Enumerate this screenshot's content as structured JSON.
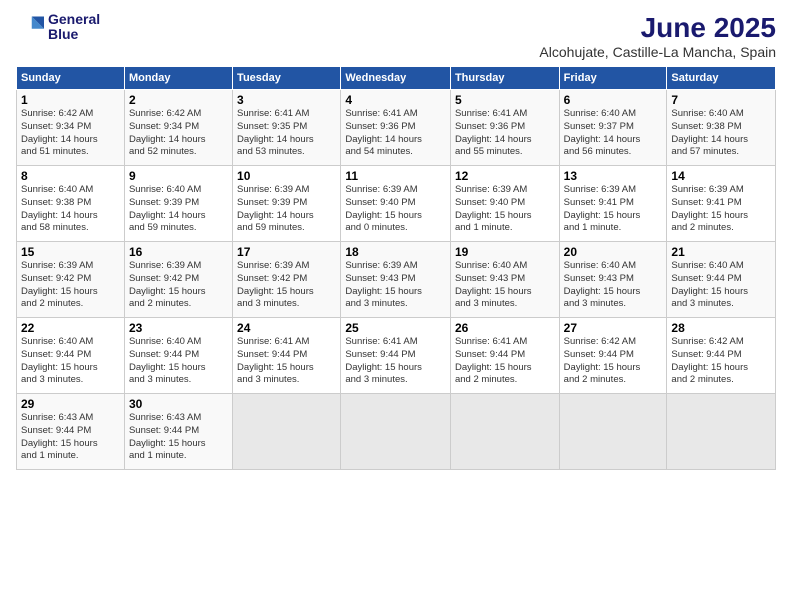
{
  "logo": {
    "line1": "General",
    "line2": "Blue"
  },
  "title": "June 2025",
  "subtitle": "Alcohujate, Castille-La Mancha, Spain",
  "days_of_week": [
    "Sunday",
    "Monday",
    "Tuesday",
    "Wednesday",
    "Thursday",
    "Friday",
    "Saturday"
  ],
  "weeks": [
    [
      {
        "day": "1",
        "info": "Sunrise: 6:42 AM\nSunset: 9:34 PM\nDaylight: 14 hours\nand 51 minutes."
      },
      {
        "day": "2",
        "info": "Sunrise: 6:42 AM\nSunset: 9:34 PM\nDaylight: 14 hours\nand 52 minutes."
      },
      {
        "day": "3",
        "info": "Sunrise: 6:41 AM\nSunset: 9:35 PM\nDaylight: 14 hours\nand 53 minutes."
      },
      {
        "day": "4",
        "info": "Sunrise: 6:41 AM\nSunset: 9:36 PM\nDaylight: 14 hours\nand 54 minutes."
      },
      {
        "day": "5",
        "info": "Sunrise: 6:41 AM\nSunset: 9:36 PM\nDaylight: 14 hours\nand 55 minutes."
      },
      {
        "day": "6",
        "info": "Sunrise: 6:40 AM\nSunset: 9:37 PM\nDaylight: 14 hours\nand 56 minutes."
      },
      {
        "day": "7",
        "info": "Sunrise: 6:40 AM\nSunset: 9:38 PM\nDaylight: 14 hours\nand 57 minutes."
      }
    ],
    [
      {
        "day": "8",
        "info": "Sunrise: 6:40 AM\nSunset: 9:38 PM\nDaylight: 14 hours\nand 58 minutes."
      },
      {
        "day": "9",
        "info": "Sunrise: 6:40 AM\nSunset: 9:39 PM\nDaylight: 14 hours\nand 59 minutes."
      },
      {
        "day": "10",
        "info": "Sunrise: 6:39 AM\nSunset: 9:39 PM\nDaylight: 14 hours\nand 59 minutes."
      },
      {
        "day": "11",
        "info": "Sunrise: 6:39 AM\nSunset: 9:40 PM\nDaylight: 15 hours\nand 0 minutes."
      },
      {
        "day": "12",
        "info": "Sunrise: 6:39 AM\nSunset: 9:40 PM\nDaylight: 15 hours\nand 1 minute."
      },
      {
        "day": "13",
        "info": "Sunrise: 6:39 AM\nSunset: 9:41 PM\nDaylight: 15 hours\nand 1 minute."
      },
      {
        "day": "14",
        "info": "Sunrise: 6:39 AM\nSunset: 9:41 PM\nDaylight: 15 hours\nand 2 minutes."
      }
    ],
    [
      {
        "day": "15",
        "info": "Sunrise: 6:39 AM\nSunset: 9:42 PM\nDaylight: 15 hours\nand 2 minutes."
      },
      {
        "day": "16",
        "info": "Sunrise: 6:39 AM\nSunset: 9:42 PM\nDaylight: 15 hours\nand 2 minutes."
      },
      {
        "day": "17",
        "info": "Sunrise: 6:39 AM\nSunset: 9:42 PM\nDaylight: 15 hours\nand 3 minutes."
      },
      {
        "day": "18",
        "info": "Sunrise: 6:39 AM\nSunset: 9:43 PM\nDaylight: 15 hours\nand 3 minutes."
      },
      {
        "day": "19",
        "info": "Sunrise: 6:40 AM\nSunset: 9:43 PM\nDaylight: 15 hours\nand 3 minutes."
      },
      {
        "day": "20",
        "info": "Sunrise: 6:40 AM\nSunset: 9:43 PM\nDaylight: 15 hours\nand 3 minutes."
      },
      {
        "day": "21",
        "info": "Sunrise: 6:40 AM\nSunset: 9:44 PM\nDaylight: 15 hours\nand 3 minutes."
      }
    ],
    [
      {
        "day": "22",
        "info": "Sunrise: 6:40 AM\nSunset: 9:44 PM\nDaylight: 15 hours\nand 3 minutes."
      },
      {
        "day": "23",
        "info": "Sunrise: 6:40 AM\nSunset: 9:44 PM\nDaylight: 15 hours\nand 3 minutes."
      },
      {
        "day": "24",
        "info": "Sunrise: 6:41 AM\nSunset: 9:44 PM\nDaylight: 15 hours\nand 3 minutes."
      },
      {
        "day": "25",
        "info": "Sunrise: 6:41 AM\nSunset: 9:44 PM\nDaylight: 15 hours\nand 3 minutes."
      },
      {
        "day": "26",
        "info": "Sunrise: 6:41 AM\nSunset: 9:44 PM\nDaylight: 15 hours\nand 2 minutes."
      },
      {
        "day": "27",
        "info": "Sunrise: 6:42 AM\nSunset: 9:44 PM\nDaylight: 15 hours\nand 2 minutes."
      },
      {
        "day": "28",
        "info": "Sunrise: 6:42 AM\nSunset: 9:44 PM\nDaylight: 15 hours\nand 2 minutes."
      }
    ],
    [
      {
        "day": "29",
        "info": "Sunrise: 6:43 AM\nSunset: 9:44 PM\nDaylight: 15 hours\nand 1 minute."
      },
      {
        "day": "30",
        "info": "Sunrise: 6:43 AM\nSunset: 9:44 PM\nDaylight: 15 hours\nand 1 minute."
      },
      null,
      null,
      null,
      null,
      null
    ]
  ]
}
